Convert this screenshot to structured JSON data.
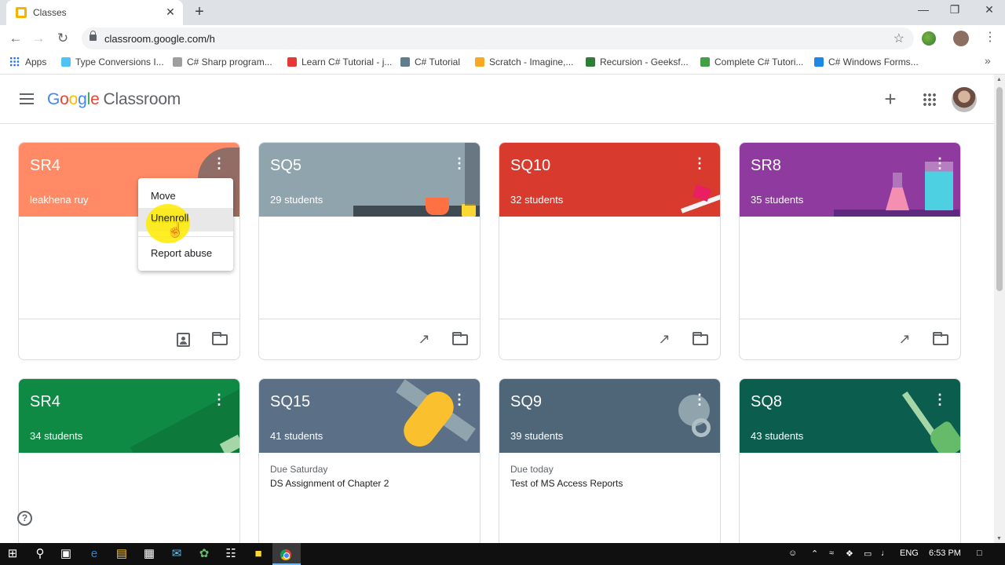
{
  "browser": {
    "tab_title": "Classes",
    "tab_close": "✕",
    "new_tab": "+",
    "url": "classroom.google.com/h",
    "window_controls": [
      "—",
      "❐",
      "✕"
    ],
    "bookmarks": [
      {
        "label": "Apps",
        "icon": "apps-grid-icon"
      },
      {
        "label": "Type Conversions I...",
        "icon": "bookmark-icon",
        "color": "#4fc3f7"
      },
      {
        "label": "C# Sharp program...",
        "icon": "w3r-icon",
        "color": "#9e9e9e"
      },
      {
        "label": "Learn C# Tutorial - j...",
        "icon": "javatpoint-icon",
        "color": "#e53935"
      },
      {
        "label": "C# Tutorial",
        "icon": "tutorial-icon",
        "color": "#607d8b"
      },
      {
        "label": "Scratch - Imagine,...",
        "icon": "scratch-icon",
        "color": "#f9a825"
      },
      {
        "label": "Recursion - Geeksf...",
        "icon": "gfg-icon",
        "color": "#2e7d32"
      },
      {
        "label": "Complete C# Tutori...",
        "icon": "complete-icon",
        "color": "#43a047"
      },
      {
        "label": "C# Windows Forms...",
        "icon": "windows-forms-icon",
        "color": "#1e88e5"
      }
    ]
  },
  "classroom": {
    "logo_google": [
      "G",
      "o",
      "o",
      "g",
      "l",
      "e"
    ],
    "logo_product": "Classroom"
  },
  "cards": [
    {
      "title": "SR4",
      "subtitle": "leakhena ruy",
      "color": "#ff8a65",
      "due_label": "",
      "due_text": ""
    },
    {
      "title": "SQ5",
      "subtitle": "29 students",
      "color": "#90a4ae",
      "due_label": "",
      "due_text": ""
    },
    {
      "title": "SQ10",
      "subtitle": "32 students",
      "color": "#d83b2e",
      "due_label": "",
      "due_text": ""
    },
    {
      "title": "SR8",
      "subtitle": "35 students",
      "color": "#8e3a9e",
      "due_label": "",
      "due_text": ""
    },
    {
      "title": "SR4",
      "subtitle": "34 students",
      "color": "#0f8a44",
      "due_label": "",
      "due_text": ""
    },
    {
      "title": "SQ15",
      "subtitle": "41 students",
      "color": "#5b7086",
      "due_label": "Due Saturday",
      "due_text": "DS Assignment of Chapter 2"
    },
    {
      "title": "SQ9",
      "subtitle": "39 students",
      "color": "#4f6679",
      "due_label": "Due today",
      "due_text": "Test of MS Access Reports"
    },
    {
      "title": "SQ8",
      "subtitle": "43 students",
      "color": "#0b5d4d",
      "due_label": "",
      "due_text": ""
    }
  ],
  "menu": {
    "items": [
      "Move",
      "Unenroll",
      "Report abuse"
    ],
    "hovered": "Unenroll"
  },
  "help": "?",
  "taskbar": {
    "language": "ENG",
    "time": "6:53 PM"
  }
}
